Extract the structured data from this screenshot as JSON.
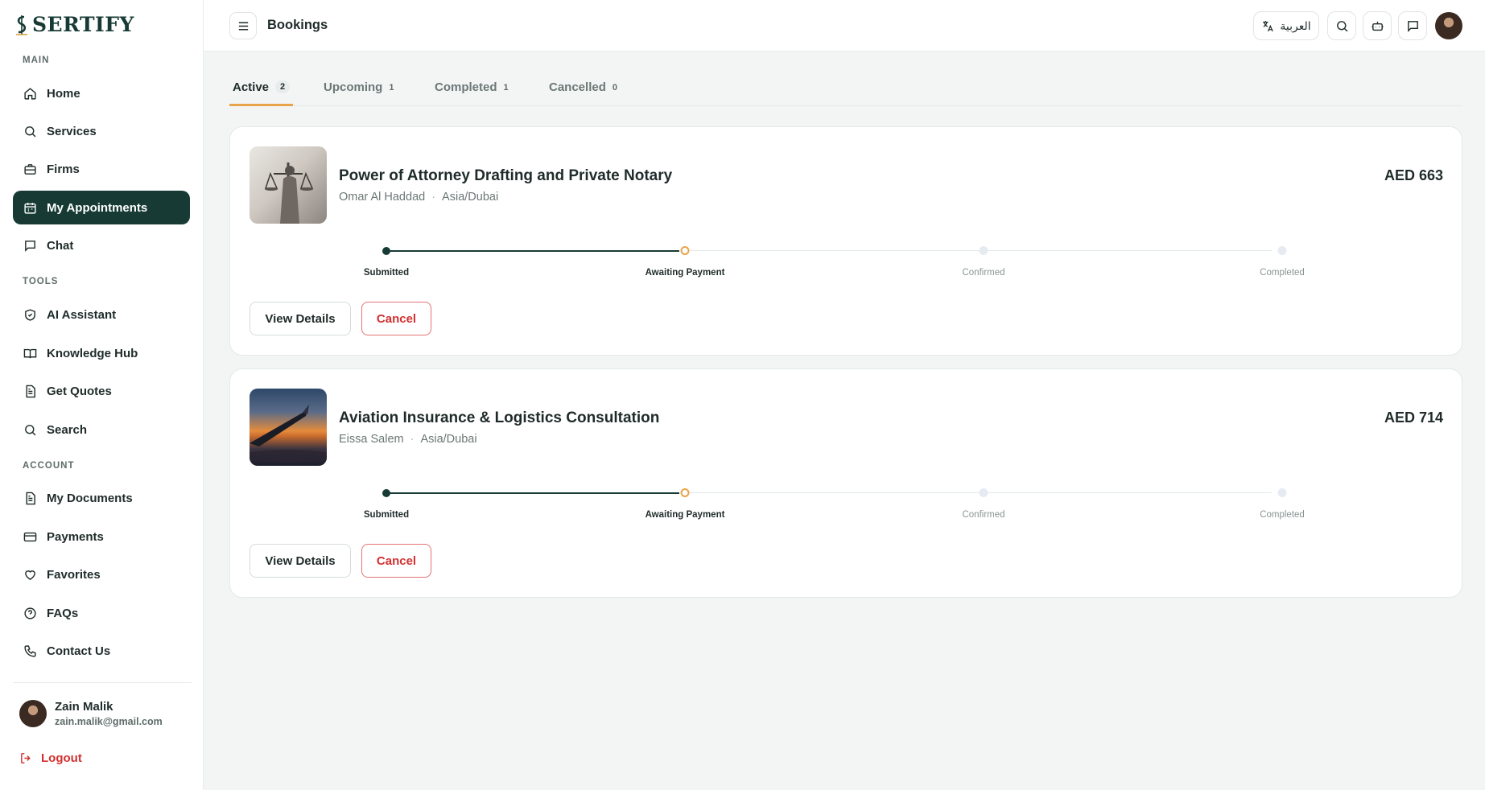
{
  "brand": {
    "name": "SERTIFY"
  },
  "sidebar": {
    "sections": [
      {
        "label": "MAIN"
      },
      {
        "label": "TOOLS"
      },
      {
        "label": "ACCOUNT"
      }
    ],
    "items": [
      {
        "label": "Home",
        "icon": "home-icon"
      },
      {
        "label": "Services",
        "icon": "search-icon"
      },
      {
        "label": "Firms",
        "icon": "briefcase-icon"
      },
      {
        "label": "My Appointments",
        "icon": "calendar-icon",
        "active": true
      },
      {
        "label": "Chat",
        "icon": "chat-icon"
      },
      {
        "label": "AI Assistant",
        "icon": "shield-check-icon"
      },
      {
        "label": "Knowledge Hub",
        "icon": "book-icon"
      },
      {
        "label": "Get Quotes",
        "icon": "document-icon"
      },
      {
        "label": "Search",
        "icon": "search-icon"
      },
      {
        "label": "My Documents",
        "icon": "document-icon"
      },
      {
        "label": "Payments",
        "icon": "credit-card-icon"
      },
      {
        "label": "Favorites",
        "icon": "heart-icon"
      },
      {
        "label": "FAQs",
        "icon": "help-circle-icon"
      },
      {
        "label": "Contact Us",
        "icon": "phone-icon"
      }
    ],
    "user": {
      "name": "Zain Malik",
      "email": "zain.malik@gmail.com"
    },
    "logout_label": "Logout"
  },
  "header": {
    "title": "Bookings",
    "language_label": "العربية"
  },
  "tabs": [
    {
      "label": "Active",
      "count": "2",
      "active": true
    },
    {
      "label": "Upcoming",
      "count": "1"
    },
    {
      "label": "Completed",
      "count": "1"
    },
    {
      "label": "Cancelled",
      "count": "0"
    }
  ],
  "bookings": [
    {
      "title": "Power of Attorney Drafting and Private Notary",
      "provider": "Omar Al Haddad",
      "timezone": "Asia/Dubai",
      "price": "AED 663",
      "steps": [
        {
          "label": "Submitted",
          "state": "done"
        },
        {
          "label": "Awaiting Payment",
          "state": "current"
        },
        {
          "label": "Confirmed",
          "state": "pending"
        },
        {
          "label": "Completed",
          "state": "pending"
        }
      ],
      "view_label": "View Details",
      "cancel_label": "Cancel"
    },
    {
      "title": "Aviation Insurance & Logistics Consultation",
      "provider": "Eissa Salem",
      "timezone": "Asia/Dubai",
      "price": "AED 714",
      "steps": [
        {
          "label": "Submitted",
          "state": "done"
        },
        {
          "label": "Awaiting Payment",
          "state": "current"
        },
        {
          "label": "Confirmed",
          "state": "pending"
        },
        {
          "label": "Completed",
          "state": "pending"
        }
      ],
      "view_label": "View Details",
      "cancel_label": "Cancel"
    }
  ],
  "colors": {
    "primary": "#173b34",
    "accent": "#e8a44a",
    "danger": "#d32f2f",
    "background": "#f3f5f5"
  }
}
